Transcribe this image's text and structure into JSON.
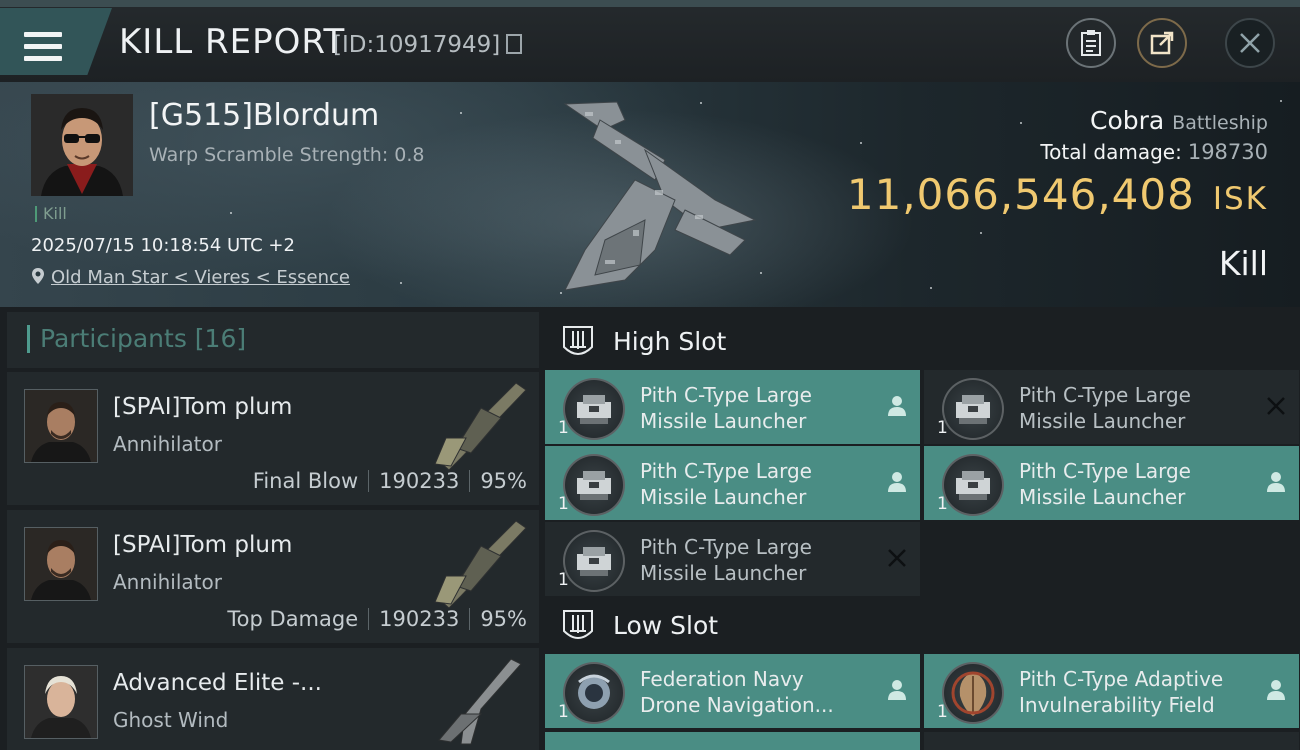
{
  "header": {
    "title": "KILL REPORT",
    "report_id": "[ID:10917949]"
  },
  "victim": {
    "name": "[G515]Blordum",
    "warp_scramble": "Warp Scramble Strength: 0.8",
    "tag": "Kill",
    "datetime": "2025/07/15 10:18:54 UTC +2",
    "location": "Old Man Star < Vieres < Essence",
    "ship_name": "Cobra",
    "ship_class": "Battleship",
    "total_damage_label": "Total damage:",
    "total_damage": "198730",
    "isk_value": "11,066,546,408",
    "isk_unit": "ISK",
    "result": "Kill"
  },
  "participants": {
    "label": "Participants [16]",
    "items": [
      {
        "name": "[SPAI]Tom plum",
        "ship": "Annihilator",
        "role": "Final Blow",
        "damage": "190233",
        "percent": "95%"
      },
      {
        "name": "[SPAI]Tom plum",
        "ship": "Annihilator",
        "role": "Top Damage",
        "damage": "190233",
        "percent": "95%"
      },
      {
        "name": "Advanced Elite -...",
        "ship": "Ghost Wind"
      }
    ]
  },
  "slots": {
    "high": {
      "label": "High Slot",
      "items": [
        {
          "line1": "Pith C-Type Large",
          "line2": "Missile Launcher",
          "qty": "1",
          "status": "person-icon"
        },
        {
          "line1": "Pith C-Type Large",
          "line2": "Missile Launcher",
          "qty": "1",
          "status": "destroyed-x-icon"
        },
        {
          "line1": "Pith C-Type Large",
          "line2": "Missile Launcher",
          "qty": "1",
          "status": "person-icon"
        },
        {
          "line1": "Pith C-Type Large",
          "line2": "Missile Launcher",
          "qty": "1",
          "status": "person-icon"
        },
        {
          "line1": "Pith C-Type Large",
          "line2": "Missile Launcher",
          "qty": "1",
          "status": "destroyed-x-icon"
        }
      ]
    },
    "low": {
      "label": "Low Slot",
      "items": [
        {
          "line1": "Federation Navy",
          "line2": "Drone Navigation...",
          "qty": "1",
          "status": "person-icon"
        },
        {
          "line1": "Pith C-Type Adaptive",
          "line2": "Invulnerability Field",
          "qty": "1",
          "status": "person-icon"
        }
      ]
    }
  },
  "colors": {
    "accent_teal": "#4a8d84",
    "isk_gold": "#f0c970",
    "panel": "#23292c"
  }
}
